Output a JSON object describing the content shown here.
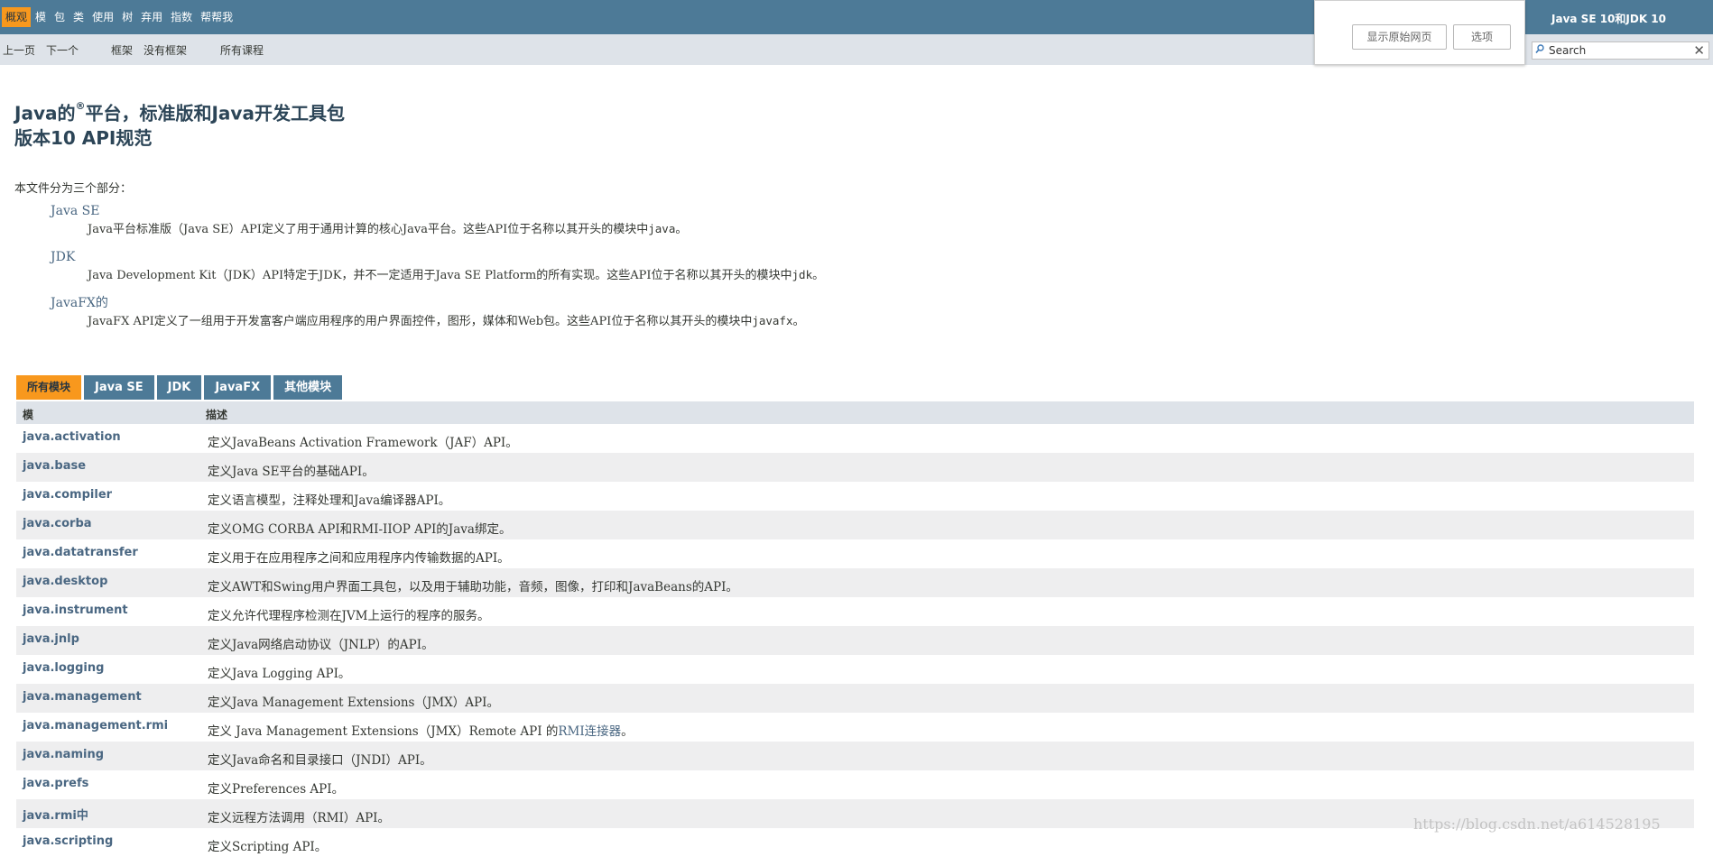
{
  "nav": {
    "items": [
      "概观",
      "模",
      "包",
      "类",
      "使用",
      "树",
      "弃用",
      "指数",
      "帮帮我"
    ],
    "active_index": 0,
    "brand": "Java SE 10和JDK 10"
  },
  "subnav": {
    "left": [
      "上一页",
      "下一个"
    ],
    "frames": [
      "框架",
      "没有框架"
    ],
    "all_classes": "所有课程"
  },
  "search": {
    "placeholder": "Search",
    "reset": "✕"
  },
  "popup": {
    "show_original": "显示原始网页",
    "options": "选项"
  },
  "header": {
    "title_prefix": "Java的",
    "title_reg": "®",
    "title_suffix": "平台，标准版和Java开发工具包",
    "subtitle": "版本10 API规范"
  },
  "intro": "本文件分为三个部分：",
  "sections": [
    {
      "term": "Java SE",
      "desc": "Java平台标准版（Java SE）API定义了用于通用计算的核心Java平台。这些API位于名称以其开头的模块中",
      "code": "java",
      "end": "。"
    },
    {
      "term": "JDK",
      "desc": "Java Development Kit（JDK）API特定于JDK，并不一定适用于Java SE Platform的所有实现。这些API位于名称以其开头的模块中",
      "code": "jdk",
      "end": "。"
    },
    {
      "term": "JavaFX的",
      "desc": "JavaFX API定义了一组用于开发富客户端应用程序的用户界面控件，图形，媒体和Web包。这些API位于名称以其开头的模块中",
      "code": "javafx",
      "end": "。"
    }
  ],
  "tabs": [
    "所有模块",
    "Java SE",
    "JDK",
    "JavaFX",
    "其他模块"
  ],
  "active_tab": 0,
  "table": {
    "headers": {
      "module": "模",
      "desc": "描述"
    },
    "rows": [
      {
        "module": "java.activation",
        "desc": "定义JavaBeans Activation Framework（JAF）API。"
      },
      {
        "module": "java.base",
        "desc": "定义Java SE平台的基础API。"
      },
      {
        "module": "java.compiler",
        "desc": "定义语言模型，注释处理和Java编译器API。"
      },
      {
        "module": "java.corba",
        "desc": "定义OMG CORBA API和RMI-IIOP API的Java绑定。"
      },
      {
        "module": "java.datatransfer",
        "desc": "定义用于在应用程序之间和应用程序内传输数据的API。"
      },
      {
        "module": "java.desktop",
        "desc": "定义AWT和Swing用户界面工具包，以及用于辅助功能，音频，图像，打印和JavaBeans的API。"
      },
      {
        "module": "java.instrument",
        "desc": "定义允许代理程序检测在JVM上运行的程序的服务。"
      },
      {
        "module": "java.jnlp",
        "desc": "定义Java网络启动协议（JNLP）的API。"
      },
      {
        "module": "java.logging",
        "desc": "定义Java Logging API。"
      },
      {
        "module": "java.management",
        "desc": "定义Java Management Extensions（JMX）API。"
      },
      {
        "module": "java.management.rmi",
        "desc": "定义 Java Management Extensions（JMX）Remote API 的",
        "link": "RMI连接器",
        "end": "。"
      },
      {
        "module": "java.naming",
        "desc": "定义Java命名和目录接口（JNDI）API。"
      },
      {
        "module": "java.prefs",
        "desc": "定义Preferences API。"
      },
      {
        "module": "java.rmi中",
        "desc": "定义远程方法调用（RMI）API。"
      },
      {
        "module": "java.scripting",
        "desc": "定义Scripting API。"
      }
    ]
  },
  "watermark": "https://blog.csdn.net/a614528195"
}
